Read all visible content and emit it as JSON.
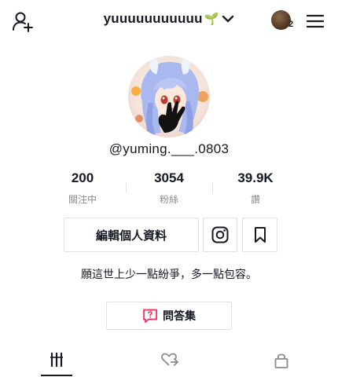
{
  "header": {
    "title": "yuuuuuuuuuuu",
    "title_emoji": "🌱",
    "notification_count": "2"
  },
  "profile": {
    "handle": "@yuming.___.0803",
    "bio": "願這世上少一點紛爭，多一點包容。"
  },
  "stats": [
    {
      "value": "200",
      "label": "關注中"
    },
    {
      "value": "3054",
      "label": "粉絲"
    },
    {
      "value": "39.9K",
      "label": "讚"
    }
  ],
  "actions": {
    "edit_label": "編輯個人資料",
    "qa_label": "問答集"
  },
  "colors": {
    "text": "#161823",
    "muted": "#8a8b91",
    "border": "#e1e1e3",
    "qa_accent": "#fe2c55"
  },
  "icons": [
    "add-user-icon",
    "chevron-down-icon",
    "menu-icon",
    "instagram-icon",
    "bookmark-icon",
    "question-box-icon",
    "grid-icon",
    "liked-icon",
    "lock-icon"
  ]
}
